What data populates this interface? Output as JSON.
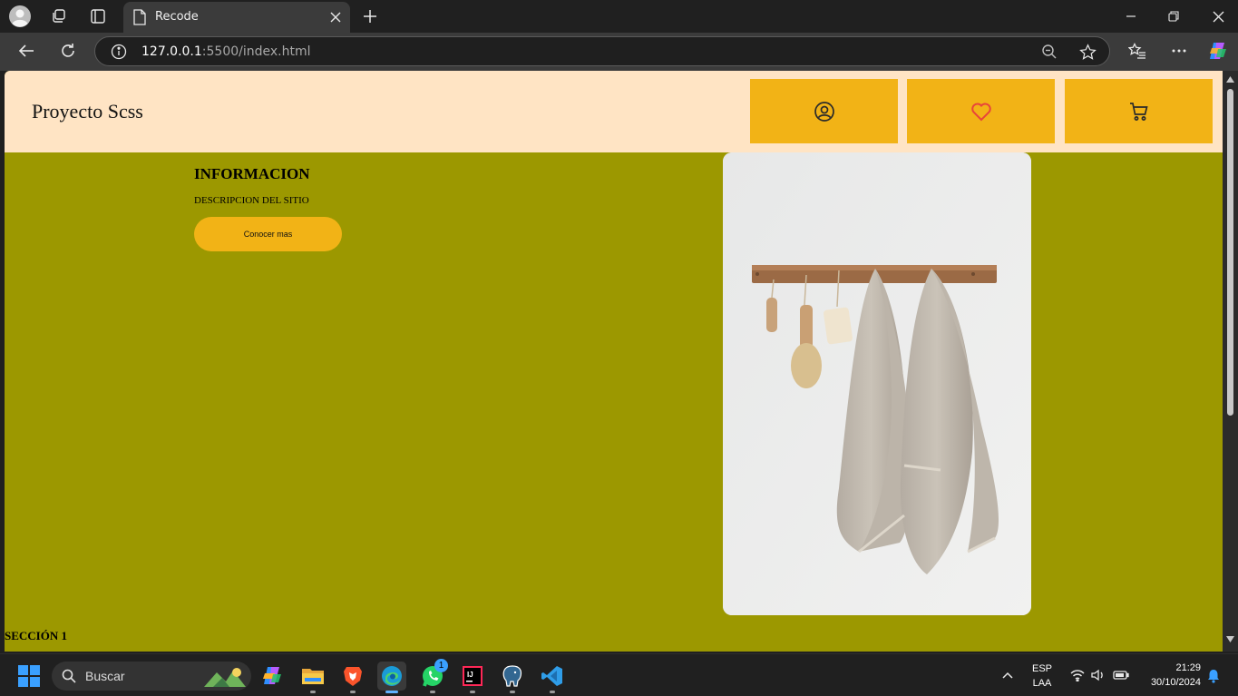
{
  "browser": {
    "tab_title": "Recode",
    "url_host": "127.0.0.1",
    "url_rest": ":5500/index.html"
  },
  "page": {
    "brand": "Proyecto Scss",
    "header_buttons": [
      {
        "icon": "user-circle-icon"
      },
      {
        "icon": "heart-icon",
        "color": "#e8443a"
      },
      {
        "icon": "cart-icon"
      }
    ],
    "hero": {
      "title": "INFORMACION",
      "description": "DESCRIPCION DEL SITIO",
      "cta_label": "Conocer mas"
    },
    "section_label": "SECCIÓN 1"
  },
  "taskbar": {
    "search_label": "Buscar",
    "whatsapp_badge": "1",
    "lang_top": "ESP",
    "lang_bottom": "LAA",
    "time": "21:29",
    "date": "30/10/2024"
  },
  "colors": {
    "page_bg": "#9c9800",
    "header_bg": "#ffe4c4",
    "accent": "#f2b316"
  }
}
